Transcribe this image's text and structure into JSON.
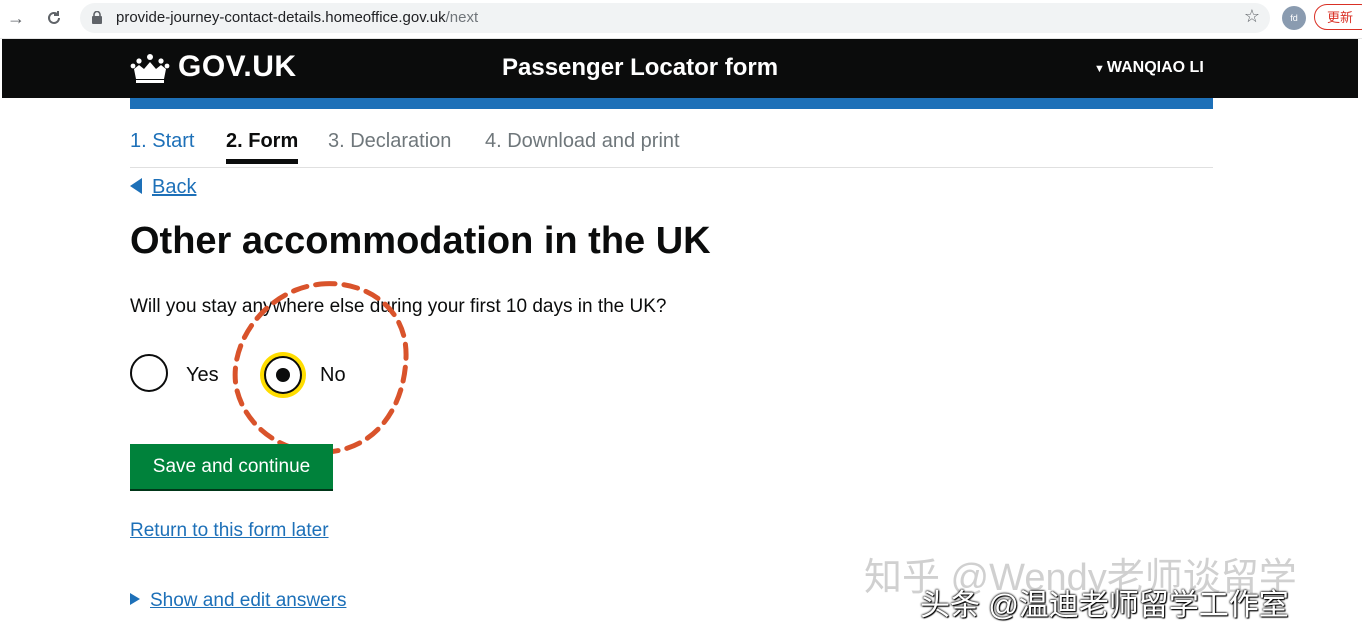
{
  "browser": {
    "url_host": "provide-journey-contact-details.homeoffice.gov.uk",
    "url_path": "/next",
    "avatar_initials": "fd",
    "update_label": "更新"
  },
  "header": {
    "logo_text": "GOV.UK",
    "service_name": "Passenger Locator form",
    "user_name": "WANQIAO LI"
  },
  "steps": [
    {
      "label": "1. Start",
      "state": "complete"
    },
    {
      "label": "2. Form",
      "state": "current"
    },
    {
      "label": "3. Declaration",
      "state": "upcoming"
    },
    {
      "label": "4. Download and print",
      "state": "upcoming"
    }
  ],
  "back_link": "Back",
  "page_title": "Other accommodation in the UK",
  "question": "Will you stay anywhere else during your first 10 days in the UK?",
  "options": [
    {
      "label": "Yes",
      "selected": false
    },
    {
      "label": "No",
      "selected": true
    }
  ],
  "save_button": "Save and continue",
  "return_link": "Return to this form later",
  "details_link": "Show and edit answers",
  "watermarks": {
    "line1": "知乎 @Wendy老师谈留学",
    "line2": "头条 @温迪老师留学工作室"
  },
  "colors": {
    "header_bg": "#0b0c0c",
    "brand_blue": "#1d70b8",
    "button_green": "#00823b",
    "focus_yellow": "#ffdd00",
    "annotation_red": "#d9532b"
  },
  "icons": {
    "reload": "reload-icon",
    "lock": "lock-icon",
    "star": "star-icon",
    "crown": "crown-icon"
  }
}
